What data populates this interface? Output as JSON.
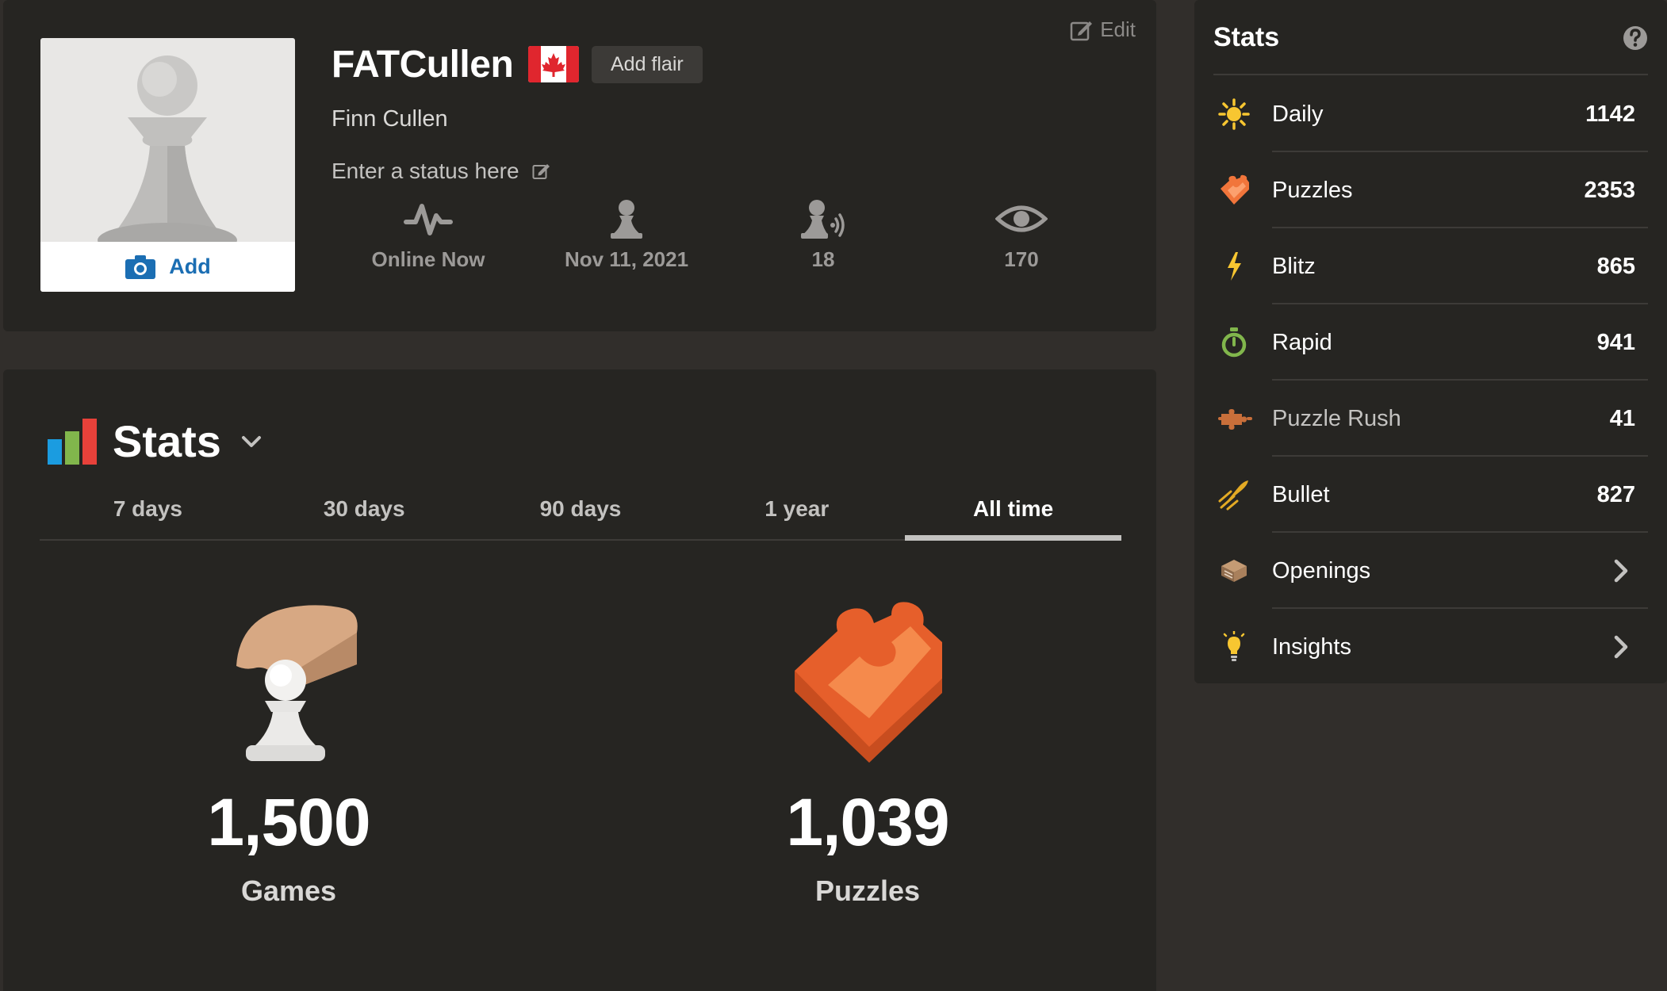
{
  "profile": {
    "avatar_add_label": "Add",
    "edit_label": "Edit",
    "username": "FATCullen",
    "flag_country": "Canada",
    "add_flair_label": "Add flair",
    "real_name": "Finn Cullen",
    "status_placeholder": "Enter a status here",
    "info": [
      {
        "icon": "activity-pulse-icon",
        "value": "Online Now"
      },
      {
        "icon": "pawn-person-icon",
        "value": "Nov 11, 2021"
      },
      {
        "icon": "followers-icon",
        "value": "18"
      },
      {
        "icon": "eye-icon",
        "value": "170"
      }
    ]
  },
  "stats_section": {
    "title": "Stats",
    "tabs": [
      {
        "label": "7 days",
        "active": false
      },
      {
        "label": "30 days",
        "active": false
      },
      {
        "label": "90 days",
        "active": false
      },
      {
        "label": "1 year",
        "active": false
      },
      {
        "label": "All time",
        "active": true
      }
    ],
    "totals": [
      {
        "icon": "hand-pawn-icon",
        "number": "1,500",
        "caption": "Games"
      },
      {
        "icon": "puzzle-piece-icon",
        "number": "1,039",
        "caption": "Puzzles"
      }
    ]
  },
  "sidebar": {
    "title": "Stats",
    "items": [
      {
        "icon": "sun-icon",
        "label": "Daily",
        "value": "1142",
        "color": "#f7c631"
      },
      {
        "icon": "puzzle-icon",
        "label": "Puzzles",
        "value": "2353",
        "color": "#f1753b"
      },
      {
        "icon": "lightning-icon",
        "label": "Blitz",
        "value": "865",
        "color": "#f7c631"
      },
      {
        "icon": "stopwatch-icon",
        "label": "Rapid",
        "value": "941",
        "color": "#81b64c"
      },
      {
        "icon": "puzzle-rush-icon",
        "label": "Puzzle Rush",
        "value": "41",
        "color": "#c96f3a"
      },
      {
        "icon": "bullet-icon",
        "label": "Bullet",
        "value": "827",
        "color": "#e3aa24"
      },
      {
        "icon": "book-icon",
        "label": "Openings",
        "value": "",
        "color": "#c49b74"
      },
      {
        "icon": "lightbulb-icon",
        "label": "Insights",
        "value": "",
        "color": "#f7c631"
      }
    ]
  }
}
